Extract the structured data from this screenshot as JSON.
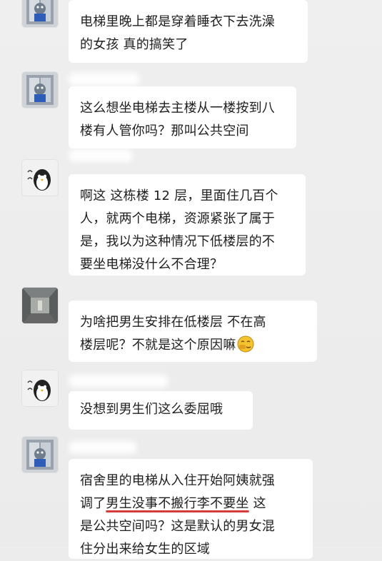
{
  "messages": [
    {
      "avatar": "elevator-avatar-icon",
      "lines": [
        "电梯里晚上都是穿着睡衣下去洗澡",
        "的女孩 真的搞笑了"
      ]
    },
    {
      "avatar": "elevator-avatar-icon",
      "lines": [
        "这么想坐电梯去主楼从一楼按到八",
        "楼有人管你吗？那叫公共空间"
      ]
    },
    {
      "avatar": "penguin-avatar-icon",
      "lines": [
        "啊这 这栋楼 12 层，里面住几百个",
        "人，就两个电梯，资源紧张了属于",
        "是，我以为这种情况下低楼层的不",
        "要坐电梯没什么不合理？"
      ]
    },
    {
      "avatar": "corridor-avatar-icon",
      "lines": [
        "为啥把男生安排在低楼层 不在高",
        "楼层呢？不就是这个原因嘛"
      ]
    },
    {
      "avatar": "penguin-avatar-icon",
      "lines": [
        "没想到男生们这么委屈哦"
      ]
    },
    {
      "avatar": "elevator-avatar-icon",
      "lines": [
        "宿舍里的电梯从入住开始阿姨就强",
        "调了",
        "男生没事不搬行李不要坐",
        " 这",
        "是公共空间吗？这是默认的男女混",
        "住分出来给女生的区域"
      ]
    }
  ]
}
